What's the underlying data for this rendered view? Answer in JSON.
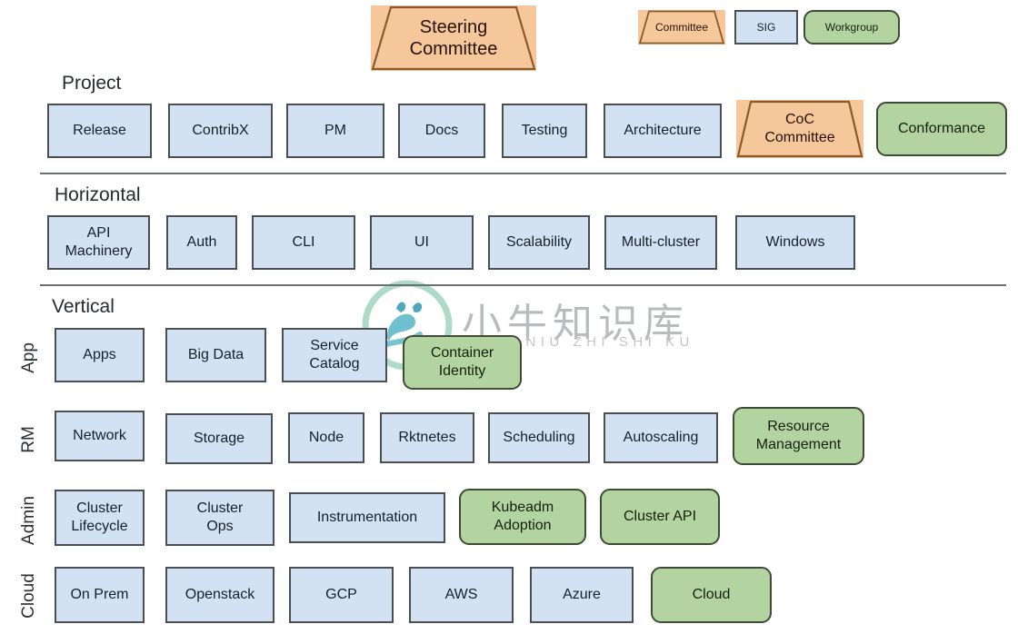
{
  "diagram": {
    "title_shape": {
      "label": "Steering\nCommittee",
      "type": "committee"
    },
    "legend": [
      {
        "label": "Committee",
        "type": "committee"
      },
      {
        "label": "SIG",
        "type": "sig"
      },
      {
        "label": "Workgroup",
        "type": "workgroup"
      }
    ],
    "sections": [
      {
        "name": "project",
        "title": "Project",
        "nodes": [
          {
            "label": "Release",
            "type": "sig"
          },
          {
            "label": "ContribX",
            "type": "sig"
          },
          {
            "label": "PM",
            "type": "sig"
          },
          {
            "label": "Docs",
            "type": "sig"
          },
          {
            "label": "Testing",
            "type": "sig"
          },
          {
            "label": "Architecture",
            "type": "sig"
          },
          {
            "label": "CoC\nCommittee",
            "type": "committee"
          },
          {
            "label": "Conformance",
            "type": "workgroup"
          }
        ]
      },
      {
        "name": "horizontal",
        "title": "Horizontal",
        "nodes": [
          {
            "label": "API\nMachinery",
            "type": "sig"
          },
          {
            "label": "Auth",
            "type": "sig"
          },
          {
            "label": "CLI",
            "type": "sig"
          },
          {
            "label": "UI",
            "type": "sig"
          },
          {
            "label": "Scalability",
            "type": "sig"
          },
          {
            "label": "Multi-cluster",
            "type": "sig"
          },
          {
            "label": "Windows",
            "type": "sig"
          }
        ]
      },
      {
        "name": "vertical",
        "title": "Vertical",
        "rows": [
          {
            "label": "App",
            "nodes": [
              {
                "label": "Apps",
                "type": "sig"
              },
              {
                "label": "Big Data",
                "type": "sig"
              },
              {
                "label": "Service\nCatalog",
                "type": "sig"
              },
              {
                "label": "Container\nIdentity",
                "type": "workgroup"
              }
            ]
          },
          {
            "label": "RM",
            "nodes": [
              {
                "label": "Network",
                "type": "sig"
              },
              {
                "label": "Storage",
                "type": "sig"
              },
              {
                "label": "Node",
                "type": "sig"
              },
              {
                "label": "Rktnetes",
                "type": "sig"
              },
              {
                "label": "Scheduling",
                "type": "sig"
              },
              {
                "label": "Autoscaling",
                "type": "sig"
              },
              {
                "label": "Resource\nManagement",
                "type": "workgroup"
              }
            ]
          },
          {
            "label": "Admin",
            "nodes": [
              {
                "label": "Cluster\nLifecycle",
                "type": "sig"
              },
              {
                "label": "Cluster\nOps",
                "type": "sig"
              },
              {
                "label": "Instrumentation",
                "type": "sig"
              },
              {
                "label": "Kubeadm\nAdoption",
                "type": "workgroup"
              },
              {
                "label": "Cluster API",
                "type": "workgroup"
              }
            ]
          },
          {
            "label": "Cloud",
            "nodes": [
              {
                "label": "On Prem",
                "type": "sig"
              },
              {
                "label": "Openstack",
                "type": "sig"
              },
              {
                "label": "GCP",
                "type": "sig"
              },
              {
                "label": "AWS",
                "type": "sig"
              },
              {
                "label": "Azure",
                "type": "sig"
              },
              {
                "label": "Cloud",
                "type": "workgroup"
              }
            ]
          }
        ]
      }
    ],
    "watermark": {
      "text_cn": "小牛知识库",
      "text_en": "XIAO NIU ZHI SHI KU",
      "logo_name": "niu-circle-logo"
    },
    "colors": {
      "sig_fill": "#d2e2f3",
      "sig_border": "#4a4f55",
      "workgroup_fill": "#b3d4a0",
      "workgroup_border": "#3f4a37",
      "committee_fill": "#f6c79a",
      "committee_border": "#8a5a2b",
      "divider": "#6a7075",
      "watermark": "#b9bcbe"
    }
  }
}
